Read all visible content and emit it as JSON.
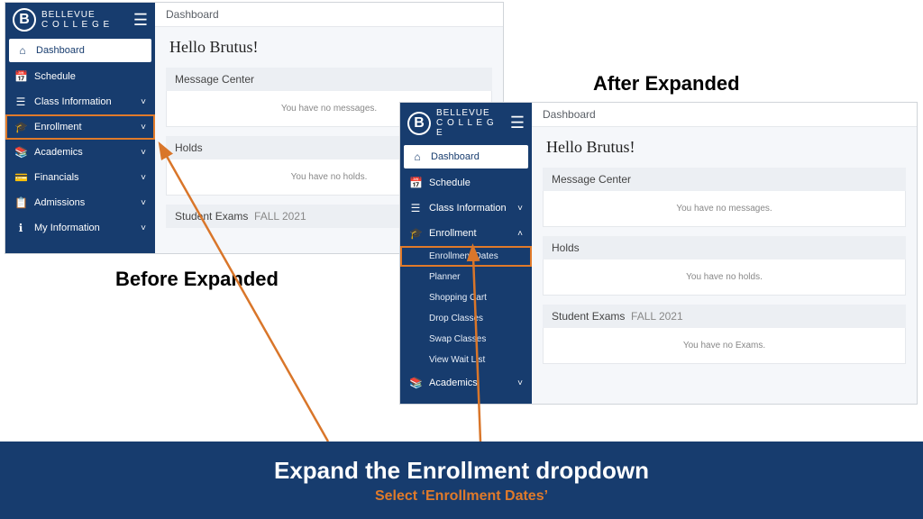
{
  "brand": {
    "name_top": "BELLEVUE",
    "name_bottom": "C O L L E G E",
    "initial": "B"
  },
  "labels": {
    "before": "Before Expanded",
    "after": "After Expanded"
  },
  "banner": {
    "title": "Expand the Enrollment dropdown",
    "subtitle": "Select ‘Enrollment Dates’"
  },
  "shared": {
    "crumb": "Dashboard",
    "hello": "Hello Brutus!",
    "msg_head": "Message Center",
    "msg_body": "You have no messages.",
    "holds_head": "Holds",
    "holds_body": "You have no holds.",
    "exams_head": "Student Exams",
    "exams_term": "FALL 2021",
    "exams_body": "You have no Exams."
  },
  "before_nav": [
    {
      "icon": "⌂",
      "label": "Dashboard",
      "active": true
    },
    {
      "icon": "📅",
      "label": "Schedule"
    },
    {
      "icon": "☰",
      "label": "Class Information",
      "chev": true
    },
    {
      "icon": "🎓",
      "label": "Enrollment",
      "chev": true,
      "highlight": true
    },
    {
      "icon": "📚",
      "label": "Academics",
      "chev": true
    },
    {
      "icon": "💳",
      "label": "Financials",
      "chev": true
    },
    {
      "icon": "📋",
      "label": "Admissions",
      "chev": true
    },
    {
      "icon": "ℹ",
      "label": "My Information",
      "chev": true
    }
  ],
  "after_nav": [
    {
      "icon": "⌂",
      "label": "Dashboard",
      "active": true
    },
    {
      "icon": "📅",
      "label": "Schedule"
    },
    {
      "icon": "☰",
      "label": "Class Information",
      "chev": true
    },
    {
      "icon": "🎓",
      "label": "Enrollment",
      "chev": true,
      "up": true,
      "subs": [
        {
          "label": "Enrollment Dates",
          "highlight": true
        },
        {
          "label": "Planner"
        },
        {
          "label": "Shopping Cart"
        },
        {
          "label": "Drop Classes"
        },
        {
          "label": "Swap Classes"
        },
        {
          "label": "View Wait List"
        }
      ]
    },
    {
      "icon": "📚",
      "label": "Academics",
      "chev": true
    }
  ]
}
